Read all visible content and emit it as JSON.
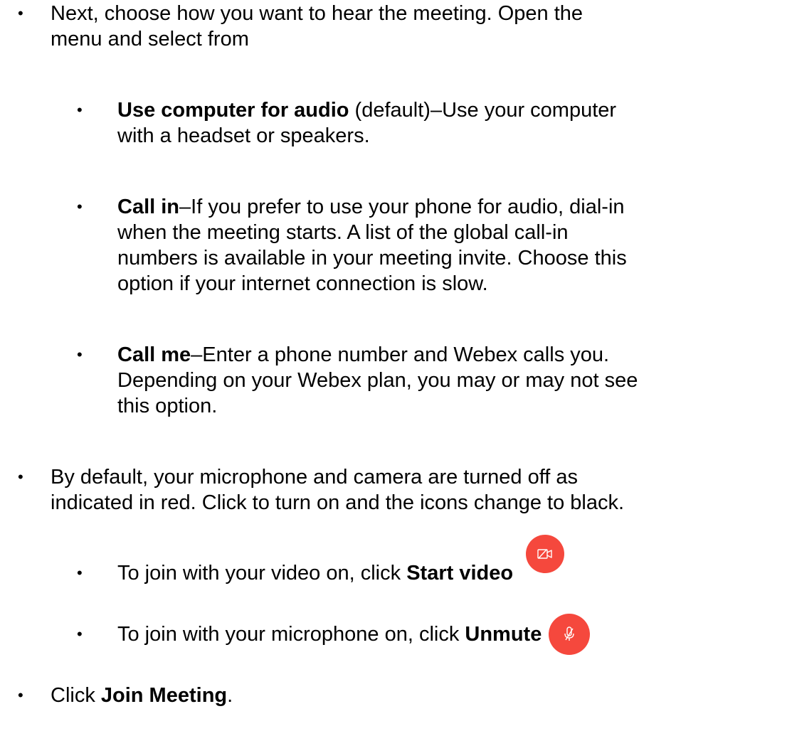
{
  "bullets": {
    "hear": {
      "line1": "Next, choose how you want to hear the meeting. Open the",
      "line2": "menu and select from"
    },
    "computer_audio": {
      "bold": "Use computer for audio",
      "line1_rest": " (default)–Use your computer",
      "line2": "with a headset or speakers."
    },
    "call_in": {
      "bold": "Call in",
      "line1_rest": "–If you prefer to use your phone for audio, dial-in",
      "line2": "when the meeting starts. A list of the global call-in",
      "line3": "numbers is available in your meeting invite. Choose this",
      "line4": "option if your internet connection is slow."
    },
    "call_me": {
      "bold": "Call me",
      "line1_rest": "–Enter a phone number and Webex calls you.",
      "line2": "Depending on your Webex plan, you may or may not see",
      "line3": "this option."
    },
    "defaults": {
      "line1": "By default, your microphone and camera are turned off as",
      "line2": "indicated in red. Click to turn on and the icons change to black."
    },
    "video": {
      "prefix": "To join with your video on, click ",
      "bold": "Start video"
    },
    "unmute": {
      "prefix": "To join with your  microphone on, click ",
      "bold": "Unmute"
    },
    "join": {
      "prefix": "Click ",
      "bold": "Join Meeting",
      "suffix": "."
    }
  },
  "bullet_glyph": "•",
  "colors": {
    "icon_background": "#f5483d",
    "icon_foreground": "#ffffff",
    "text": "#000000"
  },
  "icons": {
    "start_video": "video-off-icon",
    "unmute": "microphone-off-icon"
  }
}
